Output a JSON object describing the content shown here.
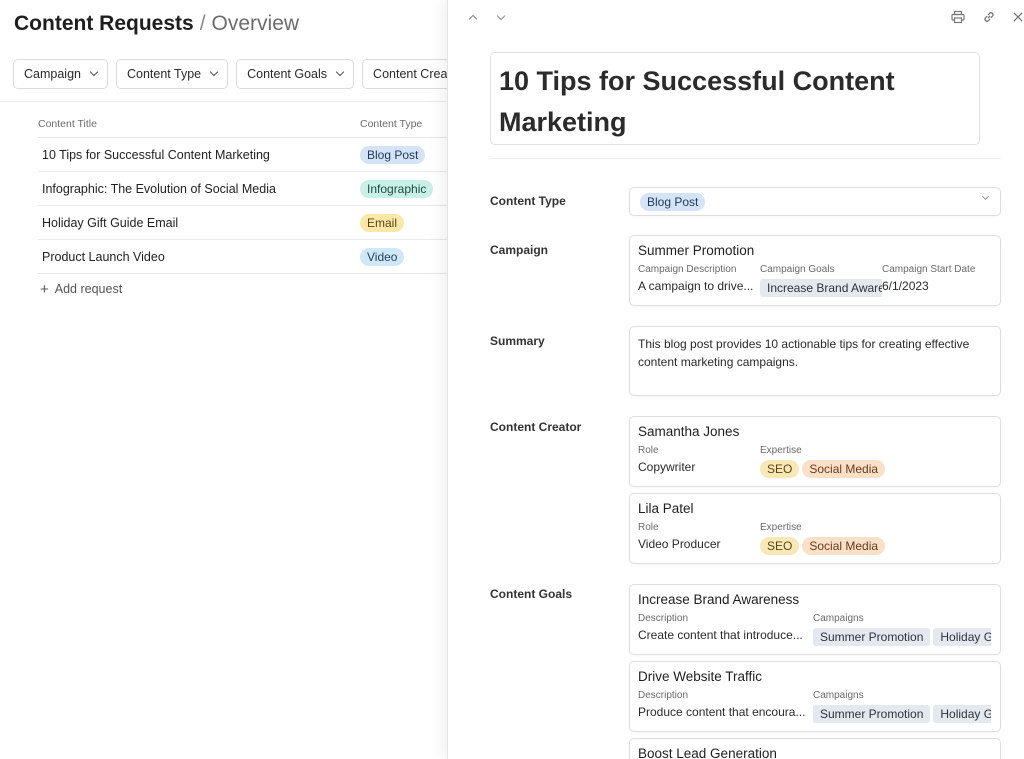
{
  "header": {
    "title": "Content Requests",
    "separator": "/",
    "view": "Overview"
  },
  "filters": [
    "Campaign",
    "Content Type",
    "Content Goals",
    "Content Creator"
  ],
  "table": {
    "columns": [
      "Content Title",
      "Content Type"
    ],
    "rows": [
      {
        "title": "10 Tips for Successful Content Marketing",
        "type": "Blog Post"
      },
      {
        "title": "Infographic: The Evolution of Social Media",
        "type": "Infographic"
      },
      {
        "title": "Holiday Gift Guide Email",
        "type": "Email"
      },
      {
        "title": "Product Launch Video",
        "type": "Video"
      }
    ],
    "add_label": "Add request"
  },
  "detail": {
    "title": "10 Tips for Successful Content Marketing",
    "fields": {
      "content_type": "Content Type",
      "campaign": "Campaign",
      "summary": "Summary",
      "content_creator": "Content Creator",
      "content_goals": "Content Goals"
    },
    "content_type_value": "Blog Post",
    "campaign": {
      "name": "Summer Promotion",
      "desc_label": "Campaign Description",
      "desc": "A campaign to drive...",
      "goals_label": "Campaign Goals",
      "goal": "Increase Brand Awareness",
      "start_label": "Campaign Start Date",
      "start": "6/1/2023"
    },
    "summary": "This blog post provides 10 actionable tips for creating effective content marketing campaigns.",
    "creators": [
      {
        "name": "Samantha Jones",
        "role_label": "Role",
        "role": "Copywriter",
        "expertise_label": "Expertise",
        "tags": [
          "SEO",
          "Social Media"
        ]
      },
      {
        "name": "Lila Patel",
        "role_label": "Role",
        "role": "Video Producer",
        "expertise_label": "Expertise",
        "tags": [
          "SEO",
          "Social Media"
        ]
      }
    ],
    "goals": [
      {
        "name": "Increase Brand Awareness",
        "desc_label": "Description",
        "desc": "Create content that introduce...",
        "campaigns_label": "Campaigns",
        "campaigns": [
          "Summer Promotion",
          "Holiday Gift"
        ]
      },
      {
        "name": "Drive Website Traffic",
        "desc_label": "Description",
        "desc": "Produce content that encoura...",
        "campaigns_label": "Campaigns",
        "campaigns": [
          "Summer Promotion",
          "Holiday Gift"
        ]
      },
      {
        "name": "Boost Lead Generation"
      }
    ]
  },
  "icons": {
    "up": "chevron-up-icon",
    "down": "chevron-down-icon",
    "print": "print-icon",
    "link": "link-icon",
    "close": "close-icon"
  }
}
